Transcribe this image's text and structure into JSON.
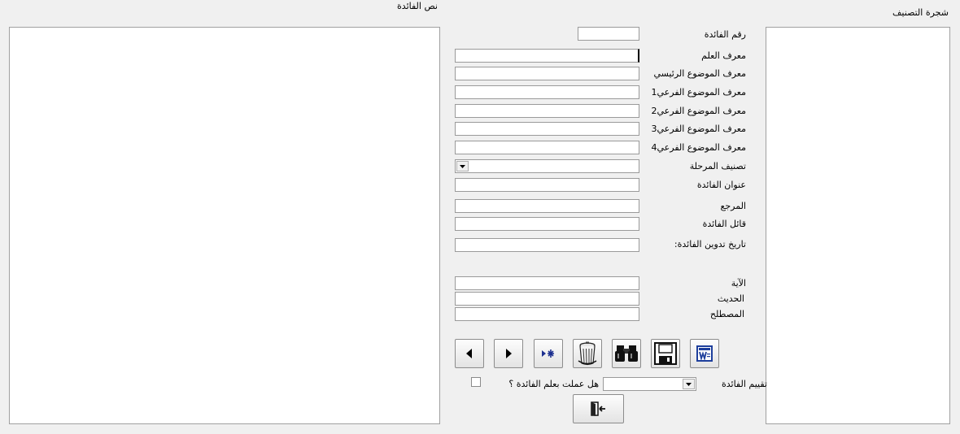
{
  "text_panel": {
    "label": "نص الفائدة"
  },
  "tree_panel": {
    "label": "شجرة التصنيف"
  },
  "form": {
    "benefit_number": {
      "label": "رقم الفائدة",
      "value": ""
    },
    "science_id": {
      "label": "معرف العلم",
      "value": ""
    },
    "main_topic_id": {
      "label": "معرف الموضوع الرئيسي",
      "value": ""
    },
    "subtopic1_id": {
      "label": "معرف الموضوع الفرعي1",
      "value": ""
    },
    "subtopic2_id": {
      "label": "معرف الموضوع الفرعي2",
      "value": ""
    },
    "subtopic3_id": {
      "label": "معرف الموضوع الفرعي3",
      "value": ""
    },
    "subtopic4_id": {
      "label": "معرف الموضوع الفرعي4",
      "value": ""
    },
    "stage_classification": {
      "label": "تصنيف المرحلة",
      "value": ""
    },
    "benefit_title": {
      "label": "عنوان الفائدة",
      "value": ""
    },
    "reference": {
      "label": "المرجع",
      "value": ""
    },
    "benefit_author": {
      "label": "قائل الفائدة",
      "value": ""
    },
    "record_date": {
      "label": "تاريخ تدوين الفائدة:",
      "value": ""
    },
    "verse": {
      "label": "الآية",
      "value": ""
    },
    "hadith": {
      "label": "الحديث",
      "value": ""
    },
    "term": {
      "label": "المصطلح",
      "value": ""
    },
    "rating": {
      "label": "تقييم الفائدة",
      "value": ""
    },
    "applied": {
      "label": "هل عملت بعلم الفائدة ؟",
      "checked": false
    }
  },
  "toolbar": {
    "buttons": [
      {
        "name": "previous-record-button",
        "icon": "arrow-left-icon"
      },
      {
        "name": "next-record-button",
        "icon": "arrow-right-icon"
      },
      {
        "name": "new-record-button",
        "icon": "new-record-icon"
      },
      {
        "name": "delete-button",
        "icon": "trash-icon"
      },
      {
        "name": "search-button",
        "icon": "binoculars-icon"
      },
      {
        "name": "save-button",
        "icon": "floppy-disk-icon"
      },
      {
        "name": "export-word-button",
        "icon": "word-icon"
      }
    ],
    "exit": {
      "name": "exit-button",
      "icon": "exit-door-icon"
    }
  },
  "colors": {
    "background": "#f0f0f0",
    "field_border": "#9a9a9a",
    "word_blue": "#1e3f9c"
  }
}
